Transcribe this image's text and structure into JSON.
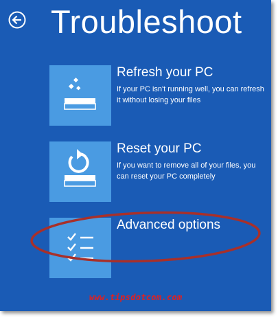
{
  "page": {
    "title": "Troubleshoot"
  },
  "navigation": {
    "back_icon": "back-arrow-icon"
  },
  "options": [
    {
      "title": "Refresh your PC",
      "description": "If your PC isn't running well, you can refresh it without losing your files",
      "icon": "refresh-pc-icon"
    },
    {
      "title": "Reset your PC",
      "description": "If you want to remove all of your files, you can reset your PC completely",
      "icon": "reset-pc-icon"
    },
    {
      "title": "Advanced options",
      "description": "",
      "icon": "checklist-icon"
    }
  ],
  "annotation": {
    "shape": "red-ellipse-highlight",
    "target": "Advanced options"
  },
  "watermark": "www.tipsdotcom.com",
  "colors": {
    "background": "#1a5bb5",
    "tile": "#4a9be2",
    "text": "#ffffff",
    "highlight": "#c0392b",
    "watermark": "#e02020"
  }
}
